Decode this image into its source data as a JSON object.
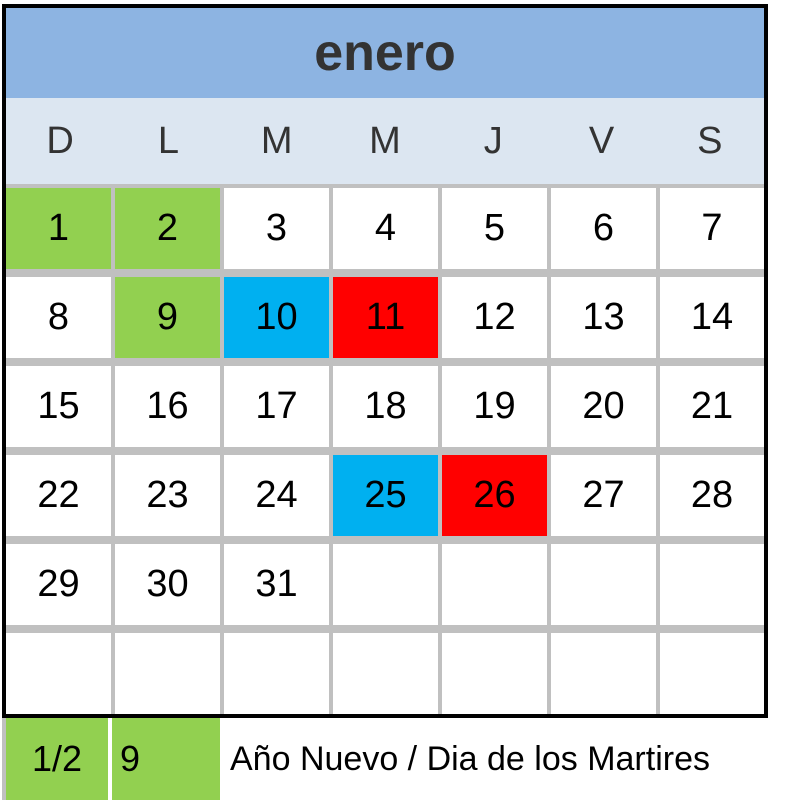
{
  "month": "enero",
  "weekdays": [
    "D",
    "L",
    "M",
    "M",
    "J",
    "V",
    "S"
  ],
  "weeks": [
    [
      "1",
      "2",
      "3",
      "4",
      "5",
      "6",
      "7"
    ],
    [
      "8",
      "9",
      "10",
      "11",
      "12",
      "13",
      "14"
    ],
    [
      "15",
      "16",
      "17",
      "18",
      "19",
      "20",
      "21"
    ],
    [
      "22",
      "23",
      "24",
      "25",
      "26",
      "27",
      "28"
    ],
    [
      "29",
      "30",
      "31",
      "",
      "",
      "",
      ""
    ],
    [
      "",
      "",
      "",
      "",
      "",
      "",
      ""
    ]
  ],
  "highlights": {
    "1": "green",
    "2": "green",
    "9": "green",
    "10": "blue",
    "11": "red",
    "25": "blue",
    "26": "red"
  },
  "colors": {
    "header_bg": "#8db4e2",
    "weekday_bg": "#dce6f1",
    "grid_line": "#c0c0c0",
    "green": "#92d050",
    "blue": "#00b0f0",
    "red": "#ff0000"
  },
  "legend": {
    "date_a": "1/2",
    "date_b": "9",
    "description": "Año Nuevo / Dia de los Martires"
  }
}
